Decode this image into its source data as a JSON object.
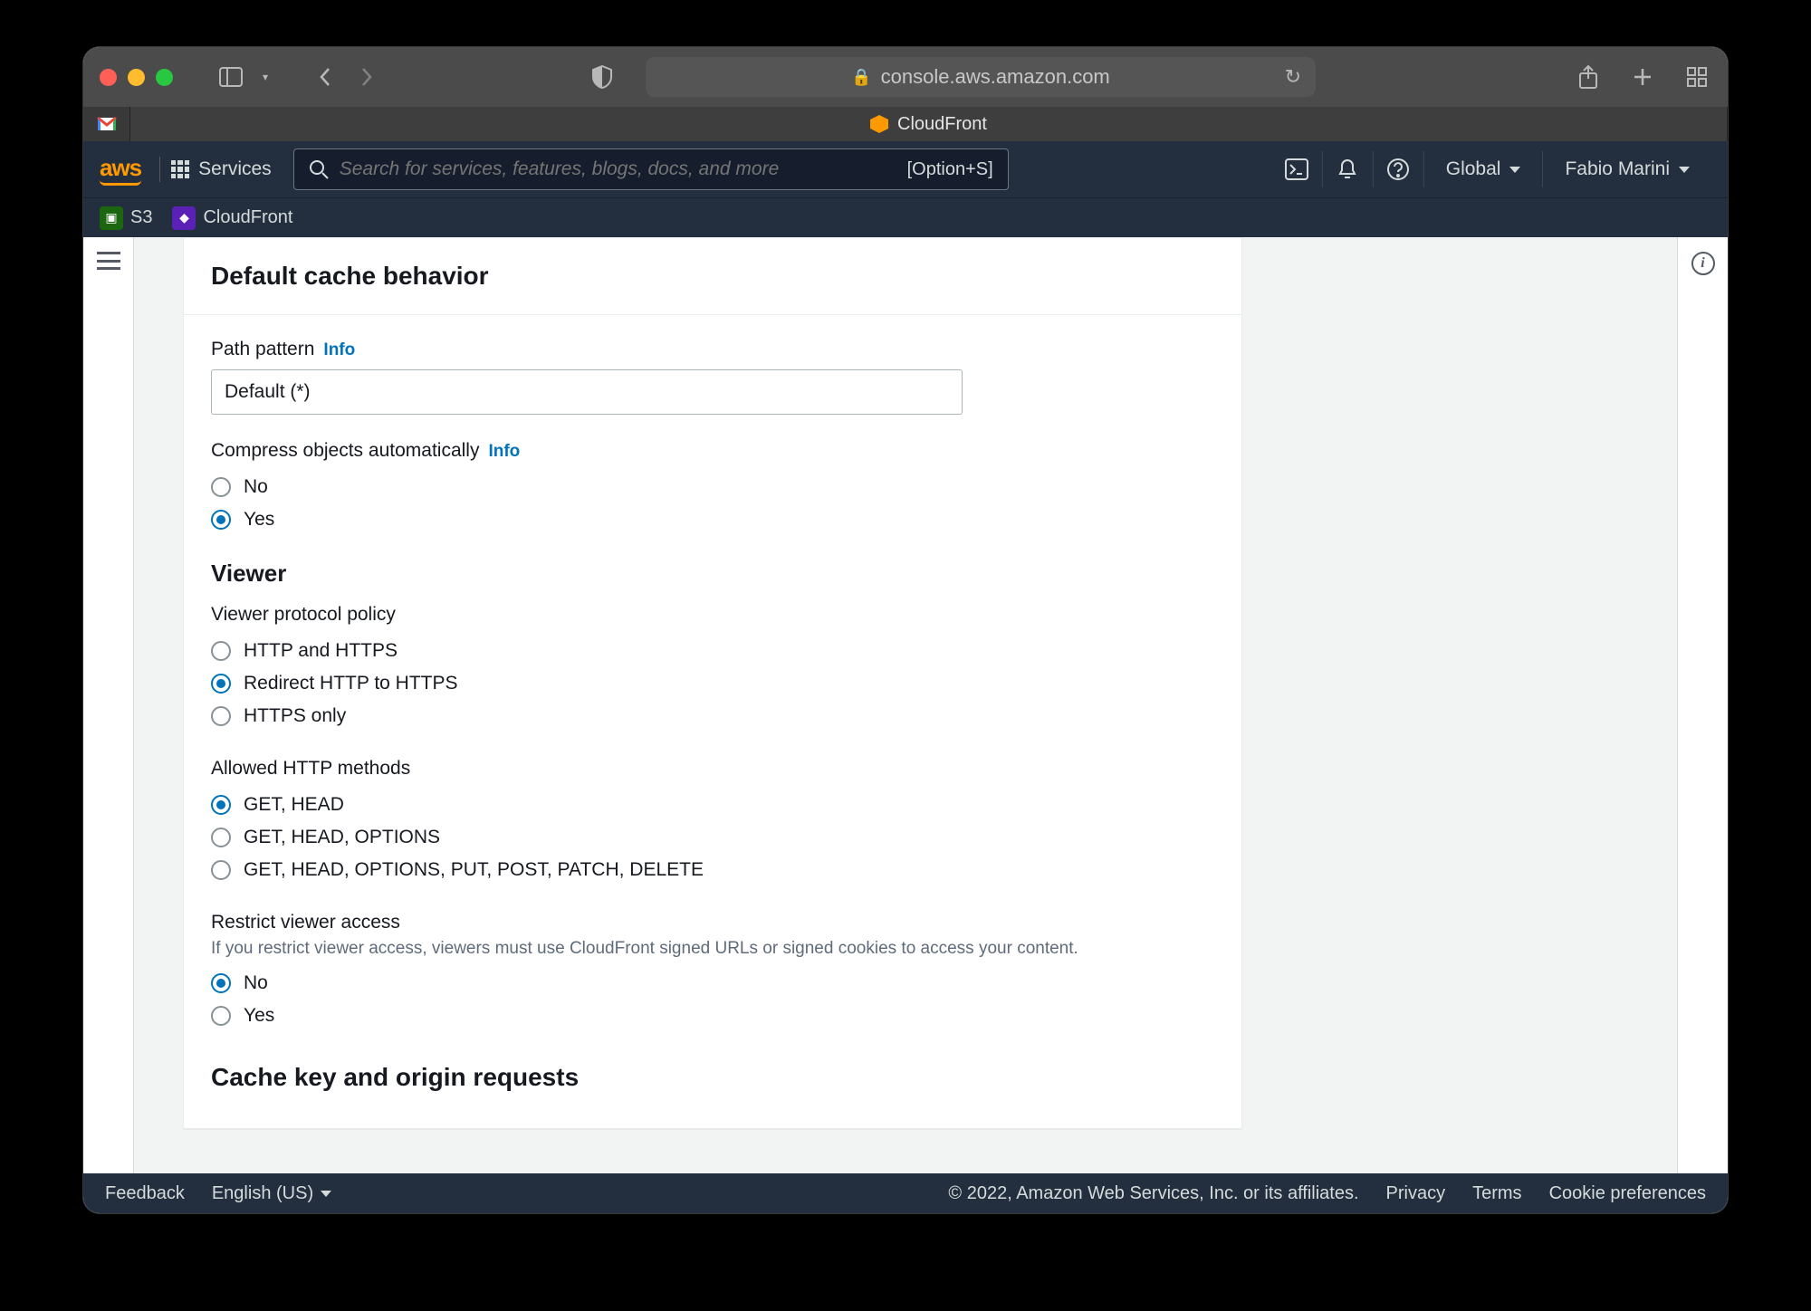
{
  "browser": {
    "url_host": "console.aws.amazon.com",
    "tab_title": "CloudFront"
  },
  "header": {
    "services_label": "Services",
    "search_placeholder": "Search for services, features, blogs, docs, and more",
    "search_shortcut": "[Option+S]",
    "region": "Global",
    "user": "Fabio Marini"
  },
  "service_bar": {
    "s3": "S3",
    "cloudfront": "CloudFront"
  },
  "panel": {
    "title": "Default cache behavior",
    "path_pattern": {
      "label": "Path pattern",
      "info": "Info",
      "value": "Default (*)"
    },
    "compress": {
      "label": "Compress objects automatically",
      "info": "Info",
      "options": [
        "No",
        "Yes"
      ],
      "selected": "Yes"
    },
    "viewer_heading": "Viewer",
    "viewer_protocol": {
      "label": "Viewer protocol policy",
      "options": [
        "HTTP and HTTPS",
        "Redirect HTTP to HTTPS",
        "HTTPS only"
      ],
      "selected": "Redirect HTTP to HTTPS"
    },
    "http_methods": {
      "label": "Allowed HTTP methods",
      "options": [
        "GET, HEAD",
        "GET, HEAD, OPTIONS",
        "GET, HEAD, OPTIONS, PUT, POST, PATCH, DELETE"
      ],
      "selected": "GET, HEAD"
    },
    "restrict": {
      "label": "Restrict viewer access",
      "hint": "If you restrict viewer access, viewers must use CloudFront signed URLs or signed cookies to access your content.",
      "options": [
        "No",
        "Yes"
      ],
      "selected": "No"
    },
    "cache_key_heading": "Cache key and origin requests"
  },
  "footer": {
    "feedback": "Feedback",
    "language": "English (US)",
    "copyright": "© 2022, Amazon Web Services, Inc. or its affiliates.",
    "privacy": "Privacy",
    "terms": "Terms",
    "cookie": "Cookie preferences"
  }
}
